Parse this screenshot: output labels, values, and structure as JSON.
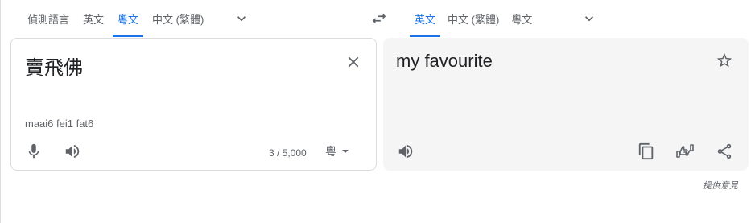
{
  "source_languages": {
    "tabs": [
      {
        "label": "偵測語言",
        "active": false
      },
      {
        "label": "英文",
        "active": false
      },
      {
        "label": "粵文",
        "active": true
      },
      {
        "label": "中文 (繁體)",
        "active": false
      }
    ]
  },
  "target_languages": {
    "tabs": [
      {
        "label": "英文",
        "active": true
      },
      {
        "label": "中文 (繁體)",
        "active": false
      },
      {
        "label": "粵文",
        "active": false
      }
    ]
  },
  "source": {
    "text": "賣飛佛",
    "transliteration": "maai6 fei1 fat6",
    "char_count": "3 / 5,000",
    "input_tool_glyph": "粵"
  },
  "target": {
    "text": "my favourite"
  },
  "feedback_label": "提供意見",
  "colors": {
    "accent": "#1a73e8",
    "icon": "#5f6368",
    "target_panel_bg": "#f5f5f5",
    "border": "#dadce0"
  },
  "icons": [
    "chevron-down-icon",
    "swap-icon",
    "close-icon",
    "microphone-icon",
    "speaker-icon",
    "star-icon",
    "copy-icon",
    "thumbs-rating-icon",
    "share-icon",
    "caret-down-icon"
  ]
}
